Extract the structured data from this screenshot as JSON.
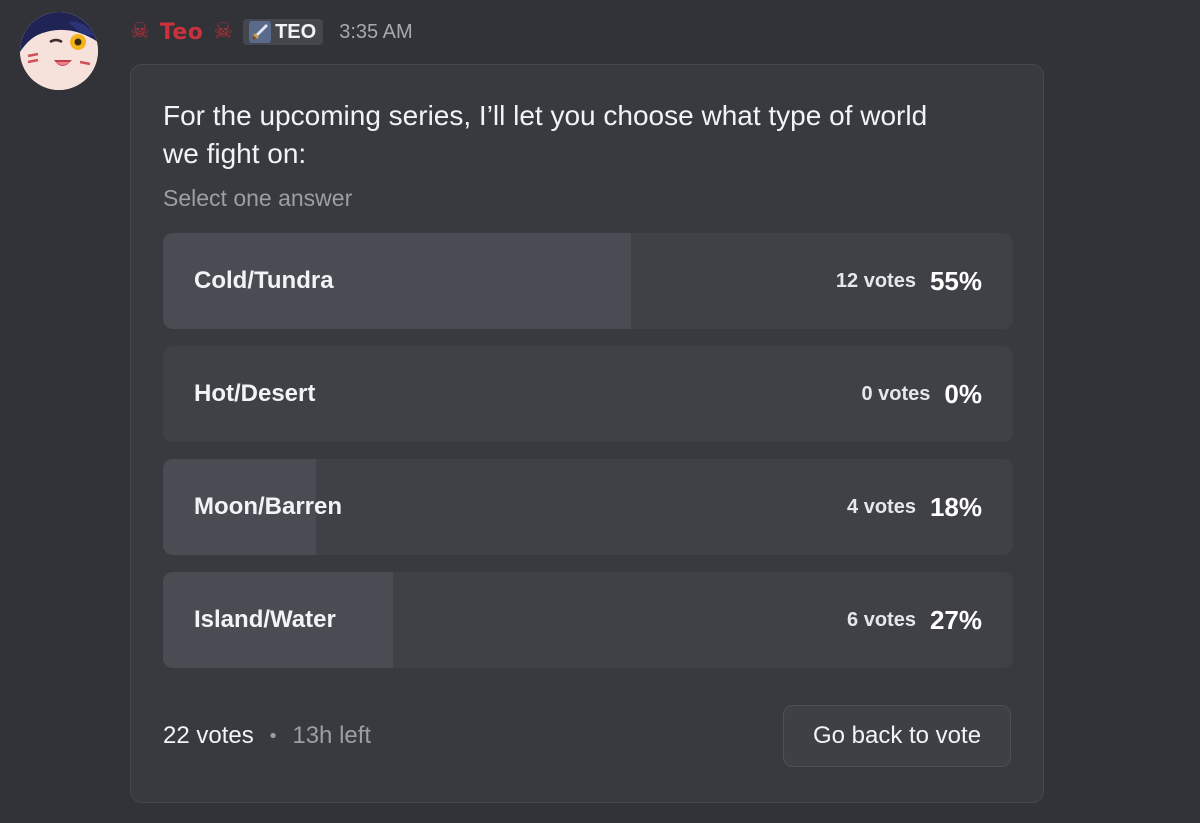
{
  "message": {
    "author": {
      "display_name": "Teo",
      "name_color": "#c9313d",
      "decoration_icon": "skull-and-crossbones-icon",
      "tag": {
        "icon": "sword-icon",
        "label": "TEO"
      }
    },
    "timestamp": "3:35 AM"
  },
  "poll": {
    "question": "For the upcoming series, I’ll let you choose what type of world we fight on:",
    "subtitle": "Select one answer",
    "answers": [
      {
        "label": "Cold/Tundra",
        "votes": "12 votes",
        "percent": "55%",
        "fill_fraction": 0.55
      },
      {
        "label": "Hot/Desert",
        "votes": "0 votes",
        "percent": "0%",
        "fill_fraction": 0.0
      },
      {
        "label": "Moon/Barren",
        "votes": "4 votes",
        "percent": "18%",
        "fill_fraction": 0.18
      },
      {
        "label": "Island/Water",
        "votes": "6 votes",
        "percent": "27%",
        "fill_fraction": 0.27
      }
    ],
    "total_votes": "22 votes",
    "separator": "•",
    "time_left": "13h left",
    "vote_button_label": "Go back to vote"
  },
  "colors": {
    "background": "#313338",
    "card": "#393a40",
    "answer_bg": "#404147",
    "answer_fill": "#4b4c53"
  }
}
